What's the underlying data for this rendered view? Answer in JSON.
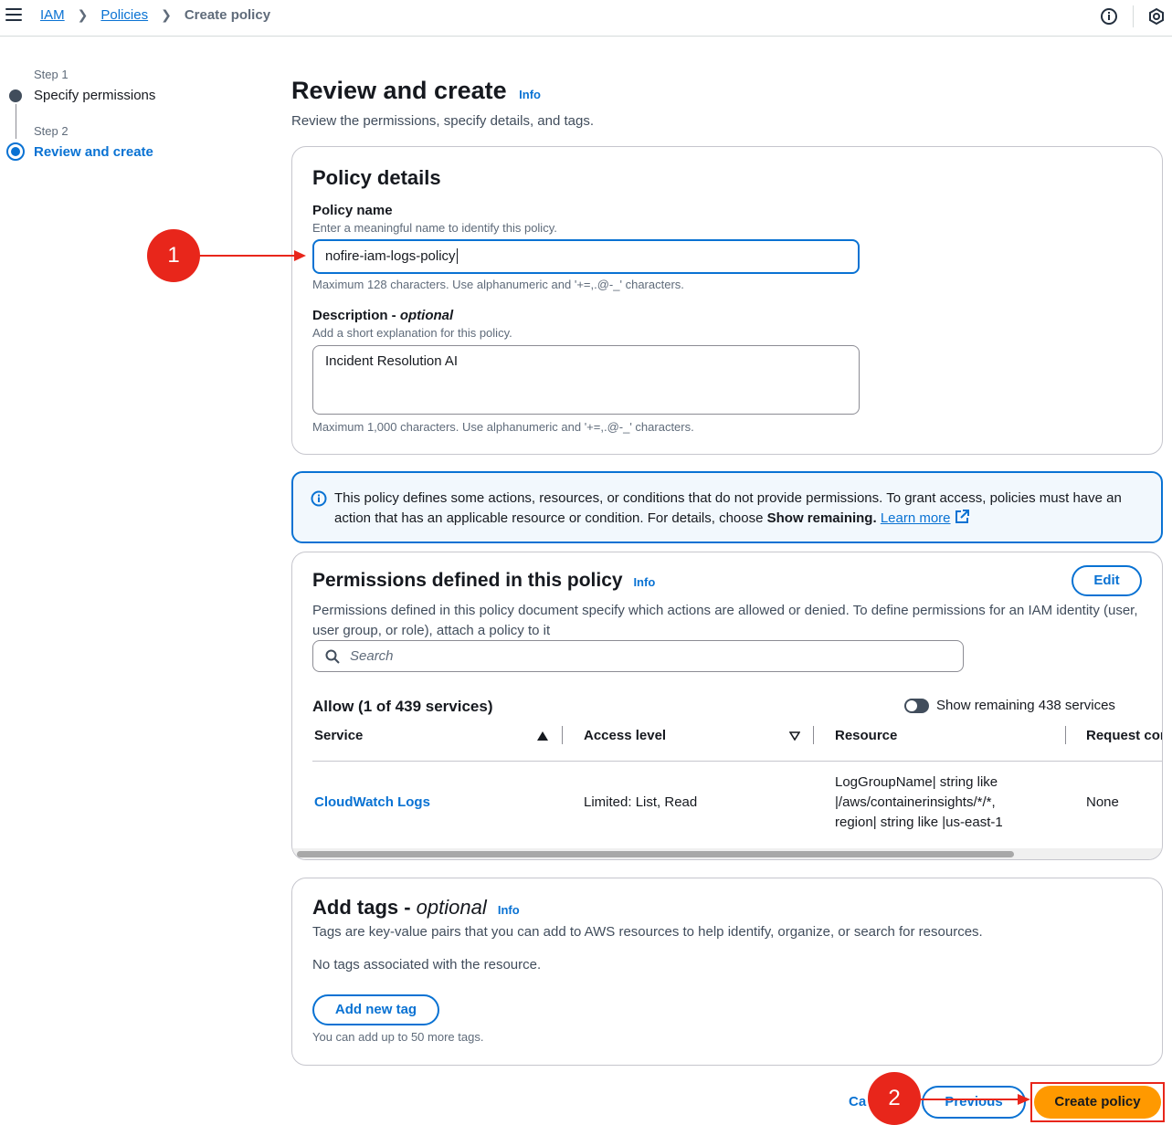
{
  "breadcrumb": {
    "items": [
      "IAM",
      "Policies"
    ],
    "current": "Create policy"
  },
  "stepper": {
    "step1_small": "Step 1",
    "step1_title": "Specify permissions",
    "step2_small": "Step 2",
    "step2_title": "Review and create"
  },
  "page": {
    "title": "Review and create",
    "info": "Info",
    "subtitle": "Review the permissions, specify details, and tags."
  },
  "policy_details": {
    "heading": "Policy details",
    "name_label": "Policy name",
    "name_hint": "Enter a meaningful name to identify this policy.",
    "name_value": "nofire-iam-logs-policy",
    "name_constraint": "Maximum 128 characters. Use alphanumeric and '+=,.@-_' characters.",
    "desc_label": "Description - ",
    "desc_optional": "optional",
    "desc_hint": "Add a short explanation for this policy.",
    "desc_value": "Incident Resolution AI",
    "desc_constraint": "Maximum 1,000 characters. Use alphanumeric and '+=,.@-_' characters."
  },
  "alert": {
    "text": "This policy defines some actions, resources, or conditions that do not provide permissions. To grant access, policies must have an action that has an applicable resource or condition. For details, choose ",
    "bold": "Show remaining.",
    "link": "Learn more"
  },
  "permissions": {
    "heading": "Permissions defined in this policy",
    "info": "Info",
    "edit_label": "Edit",
    "description": "Permissions defined in this policy document specify which actions are allowed or denied. To define permissions for an IAM identity (user, user group, or role), attach a policy to it",
    "search_placeholder": "Search",
    "allow_heading": "Allow (1 of 439 services)",
    "toggle_label": "Show remaining 438 services",
    "columns": [
      "Service",
      "Access level",
      "Resource",
      "Request cor"
    ],
    "rows": [
      {
        "service": "CloudWatch Logs",
        "access": "Limited: List, Read",
        "resource": [
          "LogGroupName| string like",
          "|/aws/containerinsights/*/*,",
          "region| string like |us-east-1"
        ],
        "request": "None"
      }
    ]
  },
  "tags": {
    "heading": "Add tags - ",
    "optional": "optional",
    "info": "Info",
    "description": "Tags are key-value pairs that you can add to AWS resources to help identify, organize, or search for resources.",
    "empty": "No tags associated with the resource.",
    "add_label": "Add new tag",
    "limit": "You can add up to 50 more tags."
  },
  "footer": {
    "cancel_label": "Ca",
    "previous_label": "Previous",
    "create_label": "Create policy"
  },
  "annotations": {
    "marker1": "1",
    "marker2": "2",
    "color": "#e8261b"
  },
  "colors": {
    "accent": "#0972d3",
    "primary_button": "#ff9900"
  }
}
